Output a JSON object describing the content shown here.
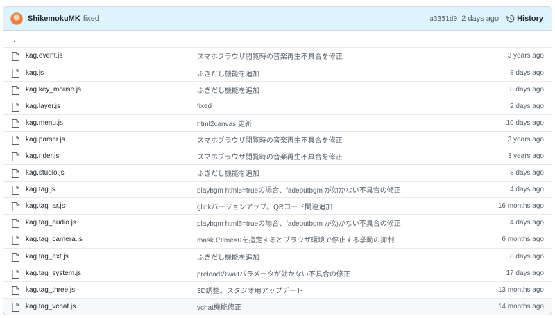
{
  "commit": {
    "author": "ShikemokuMK",
    "message": "fixed",
    "sha": "a3351d0",
    "age": "2 days ago",
    "history_label": "History"
  },
  "parent_dir_label": "..",
  "files": [
    {
      "name": "kag.event.js",
      "message": "スマホブラウザ閲覧時の音楽再生不具合を修正",
      "age": "3 years ago"
    },
    {
      "name": "kag.js",
      "message": "ふきだし機能を追加",
      "age": "8 days ago"
    },
    {
      "name": "kag.key_mouse.js",
      "message": "ふきだし機能を追加",
      "age": "8 days ago"
    },
    {
      "name": "kag.layer.js",
      "message": "fixed",
      "age": "2 days ago"
    },
    {
      "name": "kag.menu.js",
      "message": "html2canvas 更新",
      "age": "10 days ago"
    },
    {
      "name": "kag.parser.js",
      "message": "スマホブラウザ閲覧時の音楽再生不具合を修正",
      "age": "3 years ago"
    },
    {
      "name": "kag.rider.js",
      "message": "スマホブラウザ閲覧時の音楽再生不具合を修正",
      "age": "3 years ago"
    },
    {
      "name": "kag.studio.js",
      "message": "ふきだし機能を追加",
      "age": "8 days ago"
    },
    {
      "name": "kag.tag.js",
      "message": "playbgm html5=trueの場合、fadeoutbgm が効かない不具合の修正",
      "age": "4 days ago"
    },
    {
      "name": "kag.tag_ar.js",
      "message": "glinkバージョンアップ。QRコード関連追加",
      "age": "16 months ago"
    },
    {
      "name": "kag.tag_audio.js",
      "message": "playbgm html5=trueの場合、fadeoutbgm が効かない不具合の修正",
      "age": "4 days ago"
    },
    {
      "name": "kag.tag_camera.js",
      "message": "maskでtime=0を指定するとブラウザ環境で停止する挙動の抑制",
      "age": "6 months ago"
    },
    {
      "name": "kag.tag_ext.js",
      "message": "ふきだし機能を追加",
      "age": "8 days ago"
    },
    {
      "name": "kag.tag_system.js",
      "message": "preloadのwaitパラメータが効かない不具合の修正",
      "age": "17 days ago"
    },
    {
      "name": "kag.tag_three.js",
      "message": "3D調整。スタジオ用アップデート",
      "age": "13 months ago"
    },
    {
      "name": "kag.tag_vchat.js",
      "message": "vchat機能修正",
      "age": "14 months ago"
    }
  ]
}
